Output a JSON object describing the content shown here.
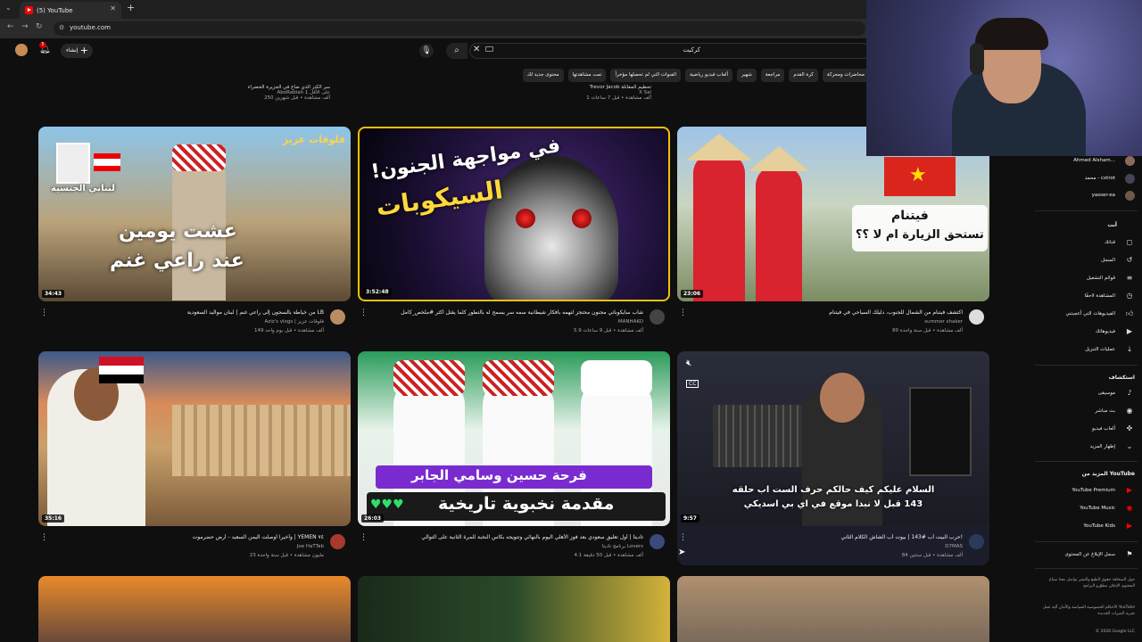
{
  "browser": {
    "tab_title": "(5) YouTube",
    "url": "youtube.com"
  },
  "header": {
    "search_query": "كركيت",
    "create_label": "إنشاء",
    "notification_count": "5"
  },
  "chips": [
    "مباشرة",
    "محاضرات ومحركة",
    "كرة القدم",
    "مراجعة",
    "شهير",
    "ألعاب فيديو رياضية",
    "الفنوات التي لم تحصلها مؤخراً",
    "تمت مشاهدتها",
    "محتوى جديد لك"
  ],
  "top_partial": [
    {
      "title": "سر الكنز الذي ضاع في الجزيرة الخضراء",
      "channel": "AboRabiah 1 على الأقل",
      "meta": "250 ألف مشاهدة • قبل شهرين"
    },
    {
      "title": "Trevor Jacob تحطيم المقاتلة",
      "channel": "X Sal",
      "meta": "1 ألف مشاهدة • قبل 7 ساعات"
    }
  ],
  "videos": [
    {
      "title": "من خياطة بالسجون إلى راعي غنم | لبنان مواليد السعودية LB",
      "channel": "Aziz's vlogs | فلوقات عزيز",
      "meta": "149 ألف مشاهدة • قبل يوم واحد",
      "duration": "34:43",
      "overlay_line1": "عشت يومين",
      "overlay_line2": "عند راعي غنم",
      "overlay_corner": "فلوقات عزيز",
      "overlay_tag": "لبناني الجنسية"
    },
    {
      "title": "شاب سايكوباتي مجنون محتجز لتهمه بأفكار شيطانية سمه سر يسمح له بالتطور كلما يقتل اكثر #ملخص_كامل",
      "channel": "MANHAKO",
      "meta": "5.9 ألف مشاهدة • قبل 9 ساعات",
      "duration": "3:52:48",
      "overlay_line1": "في مواجهة الجنون!",
      "overlay_line2": "السيكوبات"
    },
    {
      "title": "اكتشف فيتنام من الشمال للجنوب، دليلك السياحي في فيتنام",
      "channel": "summer shaker",
      "meta": "80 ألف مشاهدة • قبل سنة واحدة",
      "duration": "23:06",
      "overlay_line1": "فيتنام",
      "overlay_line2": "تستحق الزيارة ام لا ؟؟"
    },
    {
      "title": "وأخيراً أوصلت اليمن السعيد - أرض حضرموت | YEMEN ٧٤",
      "channel": "Joe HaTTab",
      "meta": "23 مليون مشاهدة • قبل سنة واحدة",
      "duration": "35:16"
    },
    {
      "title": "تاديتا | أول تعليق سعودي بعد فوز الأهلي اليوم بالنهائي وتتويجه بكأس النخبة للمرة الثانية على التوالي",
      "channel": "برنامج تاديتا Lovers",
      "meta": "4.1 ألف مشاهدة • قبل 50 دقيقة",
      "duration": "26:03",
      "overlay_line1": "فرحة حسين وسامي الجابر",
      "overlay_line2": "مقدمة نخبوية تاريخية"
    },
    {
      "title": "حرب البيت أب #143 | بيوت أب الشاش الكلام الثاني!",
      "channel": "D7MAS",
      "meta": "84 ألف مشاهدة • قبل سنتين",
      "duration": "9:57",
      "overlay_line1": "السلام عليكم كيف حالكم حرف الست اب حلقه",
      "overlay_line2": "143 قبل لا نبدا موقع في اي بي اسديكي"
    }
  ],
  "sidebar": {
    "subscriptions": [
      "Ahmed Alsham...",
      "محمد - cxtrot",
      "yasser-ea"
    ],
    "you_header": "أنت",
    "you_items": [
      "قناتك",
      "السجل",
      "قوائم التشغيل",
      "المشاهدة لاحقًا",
      "الفيديوهات التي أعجبتني",
      "فيديوهاتك",
      "عمليات التنزيل"
    ],
    "explore_header": "استكشاف",
    "explore_items": [
      "موسيقى",
      "بث مباشر",
      "ألعاب فيديو",
      "إظهار المزيد"
    ],
    "more_header": "المزيد من YouTube",
    "more_items": [
      "YouTube Premium",
      "YouTube Music",
      "YouTube Kids"
    ],
    "report_label": "سجل الإبلاغ عن المحتوى",
    "footer_1": "حول الصحافة حقوق الطبع والنشر تواصل معنا صناع المحتوى الإعلان مطوّرو البرامج",
    "footer_2": "الأحكام الخصوصية السياسة والأمان آلية عمل YouTube تجربة الميزات الجديدة",
    "copyright": "© 2026 Google LLC"
  },
  "colors": {
    "accent": "#ff0000",
    "bg": "#0f0f0f"
  }
}
